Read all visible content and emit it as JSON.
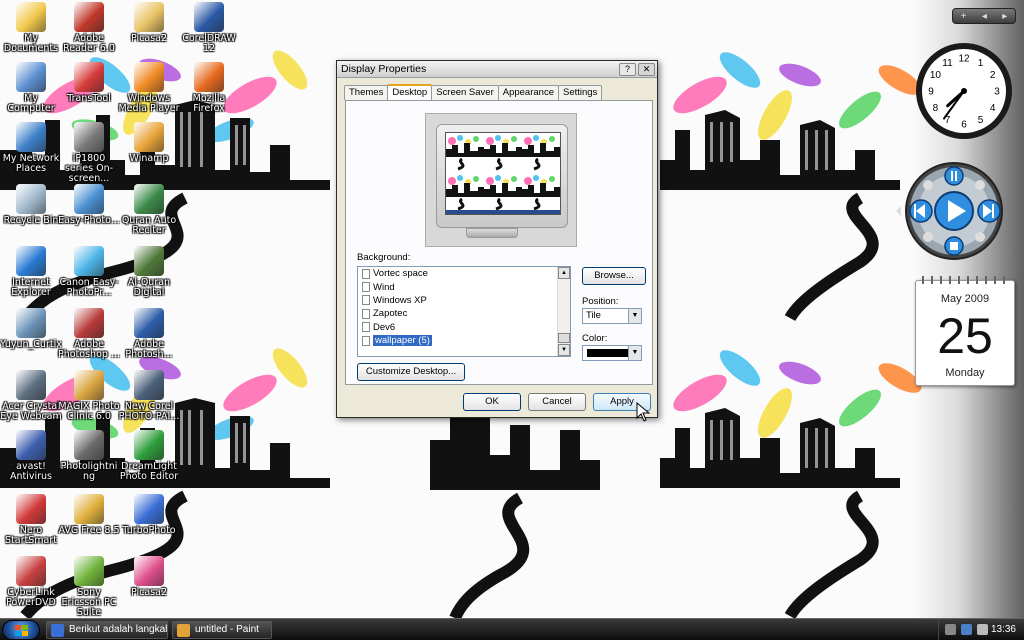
{
  "desktop": {
    "icons": [
      {
        "label": "My Documents",
        "color": "#f2c94c"
      },
      {
        "label": "Adobe Reader 6.0",
        "color": "#c0392b"
      },
      {
        "label": "Picasa2",
        "color": "#e8c365"
      },
      {
        "label": "CorelDRAW 12",
        "color": "#2b5aa6"
      },
      {
        "label": "My Computer",
        "color": "#5b8fd1"
      },
      {
        "label": "TransTool",
        "color": "#d63b3b"
      },
      {
        "label": "Windows Media Player",
        "color": "#f08a24"
      },
      {
        "label": "Mozilla Firefox",
        "color": "#e66a1f"
      },
      {
        "label": "My Network Places",
        "color": "#3d80c9"
      },
      {
        "label": "iP1800 series On-screen...",
        "color": "#7a7a7a"
      },
      {
        "label": "Winamp",
        "color": "#e8a43a"
      },
      {
        "label": "Recycle Bin",
        "color": "#9fb8cc"
      },
      {
        "label": "Easy-Photo...",
        "color": "#4a8fd1"
      },
      {
        "label": "Quran Auto Reciter",
        "color": "#3c8a49"
      },
      {
        "label": "Internet Explorer",
        "color": "#2a7ad2"
      },
      {
        "label": "Canon Easy-PhotoPr...",
        "color": "#4bb4e6"
      },
      {
        "label": "Al-Quran Digital",
        "color": "#4f7a3a"
      },
      {
        "label": "Yuyun_Curtix",
        "color": "#6c93b8"
      },
      {
        "label": "Adobe Photoshop ...",
        "color": "#b83a3a"
      },
      {
        "label": "Adobe Photosh...",
        "color": "#2d5da8"
      },
      {
        "label": "Acer Crystal Eye Webcam",
        "color": "#5c6f80"
      },
      {
        "label": "MAGIX Photo Clinic 6.0",
        "color": "#d9a441"
      },
      {
        "label": "New Corel PHOTO-PAI...",
        "color": "#4a5f7a"
      },
      {
        "label": "avast! Antivirus",
        "color": "#3d5fb0"
      },
      {
        "label": "Photolightning",
        "color": "#6a6a6a"
      },
      {
        "label": "DreamLight Photo Editor",
        "color": "#2f9e3c"
      },
      {
        "label": "Nero StartSmart",
        "color": "#d23a3a"
      },
      {
        "label": "AVG Free 8.5",
        "color": "#e0b03c"
      },
      {
        "label": "TurboPhoto",
        "color": "#3a6fd6"
      },
      {
        "label": "CyberLink PowerDVD",
        "color": "#c84141"
      },
      {
        "label": "Sony Ericsson PC Suite",
        "color": "#6fb33a"
      },
      {
        "label": "Picasa2",
        "color": "#e04f8c"
      }
    ]
  },
  "gadgets": {
    "bar_symbols": [
      "+",
      "◂",
      "▸"
    ],
    "clock": {
      "hour": 7,
      "minute": 36,
      "numerals": [
        "12",
        "1",
        "2",
        "3",
        "4",
        "5",
        "6",
        "7",
        "8",
        "9",
        "10",
        "11"
      ]
    },
    "calendar": {
      "month_year": "May 2009",
      "day": "25",
      "weekday": "Monday"
    }
  },
  "dialog": {
    "title": "Display Properties",
    "help_symbol": "?",
    "close_symbol": "✕",
    "tabs": [
      "Themes",
      "Desktop",
      "Screen Saver",
      "Appearance",
      "Settings"
    ],
    "active_tab": "Desktop",
    "background_label": "Background:",
    "background_items": [
      "Vortec space",
      "Wind",
      "Windows XP",
      "Zapotec",
      "Dev6",
      "wallpaper (5)"
    ],
    "selected_background": "wallpaper (5)",
    "browse_label": "Browse...",
    "position_label": "Position:",
    "position_value": "Tile",
    "color_label": "Color:",
    "color_value": "#000000",
    "customize_label": "Customize Desktop...",
    "ok_label": "OK",
    "cancel_label": "Cancel",
    "apply_label": "Apply"
  },
  "taskbar": {
    "tasks": [
      {
        "label": "Berikut adalah langkah...",
        "color": "#3a6fd6"
      },
      {
        "label": "untitled - Paint",
        "color": "#e2a23a"
      }
    ],
    "time": "13:36"
  }
}
